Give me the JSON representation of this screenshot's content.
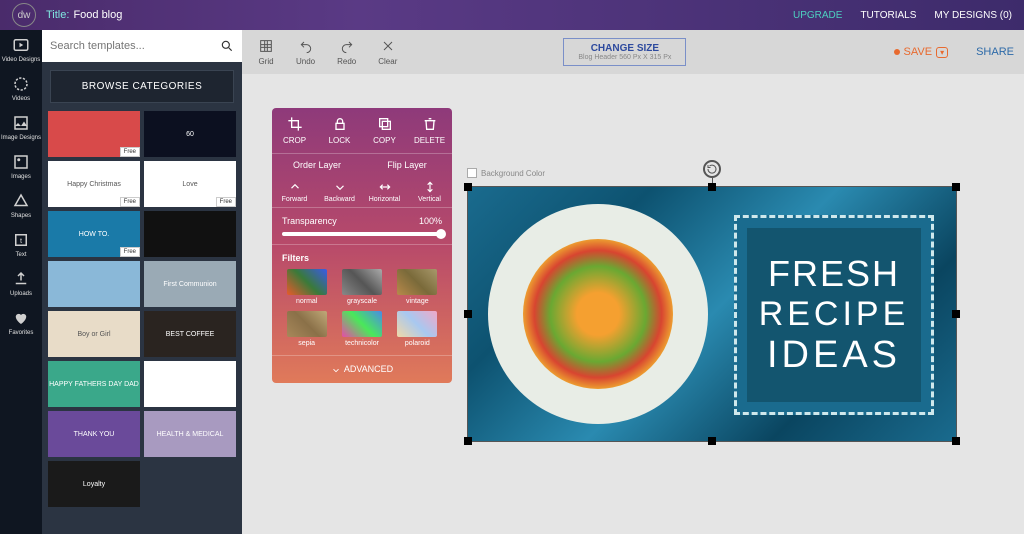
{
  "topbar": {
    "logo": "dw",
    "title_label": "Title:",
    "title_value": "Food blog",
    "upgrade": "UPGRADE",
    "tutorials": "TUTORIALS",
    "my_designs": "MY DESIGNS (0)"
  },
  "rail": [
    {
      "label": "Video Designs"
    },
    {
      "label": "Videos"
    },
    {
      "label": "Image Designs"
    },
    {
      "label": "Images"
    },
    {
      "label": "Shapes"
    },
    {
      "label": "Text"
    },
    {
      "label": "Uploads"
    },
    {
      "label": "Favorites"
    }
  ],
  "sidepanel": {
    "search_placeholder": "Search templates...",
    "browse": "BROWSE CATEGORIES",
    "templates": [
      {
        "text": "",
        "bg": "#d84a4a",
        "tag": "Free"
      },
      {
        "text": "60",
        "bg": "#0c1020",
        "tag": ""
      },
      {
        "text": "Happy Christmas",
        "bg": "#ffffff",
        "tag": "Free"
      },
      {
        "text": "Love",
        "bg": "#ffffff",
        "tag": "Free"
      },
      {
        "text": "HOW TO.",
        "bg": "#1a7aa8",
        "tag": "Free"
      },
      {
        "text": "",
        "bg": "#111111",
        "tag": ""
      },
      {
        "text": "",
        "bg": "#8ab8d8",
        "tag": ""
      },
      {
        "text": "First Communion",
        "bg": "#9aaab5",
        "tag": ""
      },
      {
        "text": "Boy or Girl",
        "bg": "#e8dcc8",
        "tag": ""
      },
      {
        "text": "BEST COFFEE",
        "bg": "#2a2420",
        "tag": ""
      },
      {
        "text": "HAPPY FATHERS DAY DAD",
        "bg": "#3aa88a",
        "tag": ""
      },
      {
        "text": "",
        "bg": "#ffffff",
        "tag": ""
      },
      {
        "text": "THANK YOU",
        "bg": "#6a4a9a",
        "tag": ""
      },
      {
        "text": "HEALTH & MEDICAL",
        "bg": "#a89ac0",
        "tag": ""
      },
      {
        "text": "Loyalty",
        "bg": "#1a1a1a",
        "tag": ""
      }
    ]
  },
  "toolbar": {
    "grid": "Grid",
    "undo": "Undo",
    "redo": "Redo",
    "clear": "Clear",
    "change_size": "CHANGE SIZE",
    "size_detail": "Blog Header 560 Px X 315 Px",
    "save": "SAVE",
    "share": "SHARE"
  },
  "props": {
    "crop": "CROP",
    "lock": "LOCK",
    "copy": "COPY",
    "delete": "DELETE",
    "order": "Order Layer",
    "flip": "Flip Layer",
    "forward": "Forward",
    "backward": "Backward",
    "horizontal": "Horizontal",
    "vertical": "Vertical",
    "transparency": "Transparency",
    "transparency_val": "100%",
    "filters": "Filters",
    "filter_list": [
      {
        "name": "normal",
        "bg": "linear-gradient(45deg,#e85a2a,#3a7a3a,#3a5ae8)"
      },
      {
        "name": "grayscale",
        "bg": "linear-gradient(45deg,#888,#555,#aaa)"
      },
      {
        "name": "vintage",
        "bg": "linear-gradient(45deg,#b88a4a,#7a6a3a,#a8986a)"
      },
      {
        "name": "sepia",
        "bg": "linear-gradient(45deg,#a8885a,#8a7048,#c0a878)"
      },
      {
        "name": "technicolor",
        "bg": "linear-gradient(45deg,#e84aa8,#4ae85a,#4a8ae8)"
      },
      {
        "name": "polaroid",
        "bg": "linear-gradient(45deg,#f0d8a8,#a8c8f0,#f0a8c8)"
      }
    ],
    "advanced": "ADVANCED"
  },
  "design": {
    "bgcolor_label": "Background Color",
    "poster": {
      "l1": "FRESH",
      "l2": "RECIPE",
      "l3": "IDEAS"
    }
  }
}
